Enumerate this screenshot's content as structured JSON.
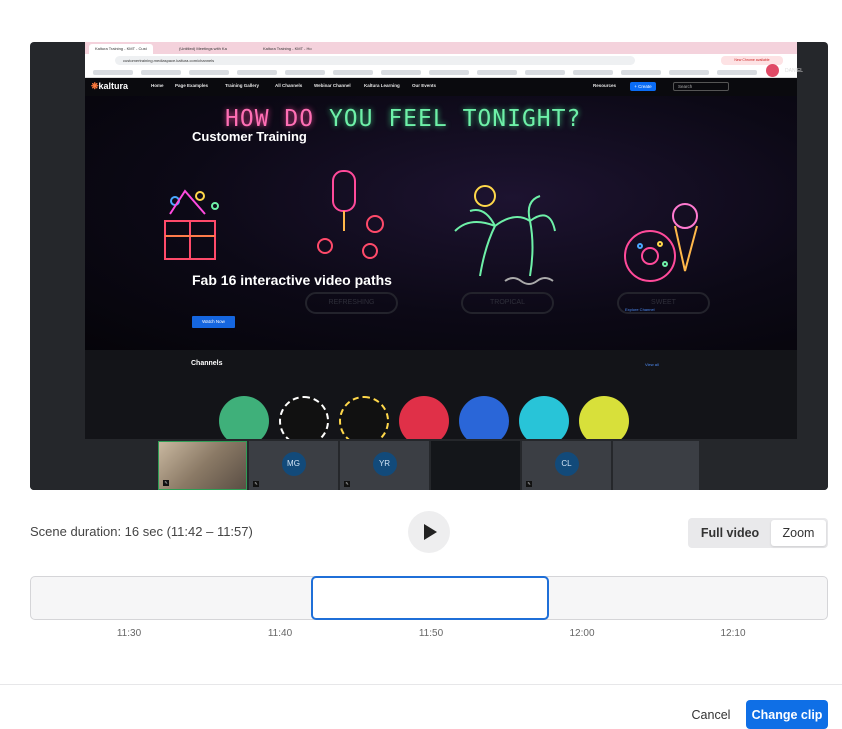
{
  "video": {
    "browser": {
      "tabs": [
        "Kaltura Training - KMT - Cust",
        "(Untitled) Meetings with Ka",
        "Kaltura Training - KMT - Ho"
      ],
      "url": "customertraining.mediaspace.kaltura.com/channels",
      "extension_label": "New Chrome available",
      "profile_name": "DANIEL"
    },
    "site": {
      "logo": "kaltura",
      "nav": [
        "Home",
        "Page Examples",
        "Training Gallery",
        "All Channels",
        "Webinar Channel",
        "Kaltura Learning",
        "Our Events"
      ],
      "resources": "Resources",
      "create": "+ Create",
      "search_placeholder": "Search",
      "neon_headline_a": "HOW DO",
      "neon_headline_b": " YOU FEEL TONIGHT?",
      "hero_title": "Customer Training",
      "hero_subtitle": "Fab 16 interactive video paths",
      "watch_button": "Watch Now",
      "ghost_buttons": [
        "REFRESHING",
        "TROPICAL",
        "SWEET"
      ],
      "ghost_link": "Explore Channel",
      "channels_title": "Channels",
      "channels_link": "View all"
    },
    "participants": [
      {
        "initials": "",
        "type": "camera"
      },
      {
        "initials": "MG",
        "type": "avatar"
      },
      {
        "initials": "YR",
        "type": "avatar"
      },
      {
        "initials": "",
        "type": "dark"
      },
      {
        "initials": "CL",
        "type": "avatar"
      },
      {
        "initials": "",
        "type": "empty"
      }
    ]
  },
  "scene": {
    "duration_text": "Scene duration: 16 sec (11:42 – 11:57)"
  },
  "view_toggle": {
    "full_label": "Full video",
    "zoom_label": "Zoom",
    "selected": "Zoom"
  },
  "timeline": {
    "ticks": [
      "11:30",
      "11:40",
      "11:50",
      "12:00",
      "12:10"
    ]
  },
  "footer": {
    "cancel_label": "Cancel",
    "change_label": "Change clip"
  },
  "colors": {
    "accent": "#0f6fe6",
    "selection_border": "#1f6fd8"
  }
}
